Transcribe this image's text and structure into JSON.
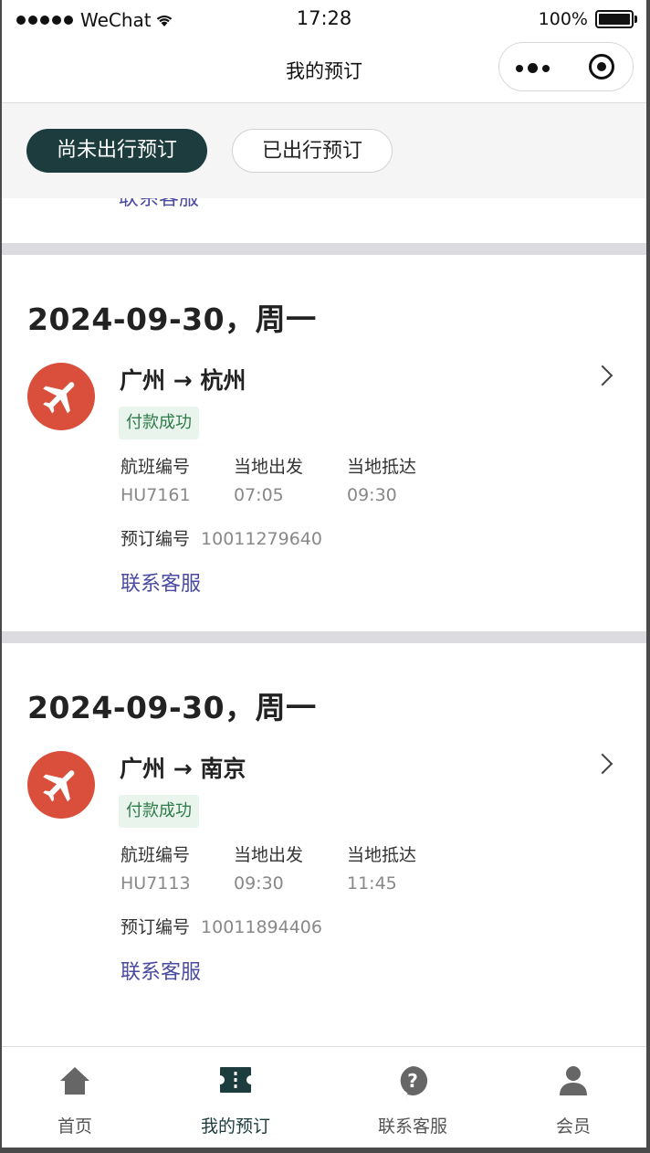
{
  "status_bar": {
    "carrier": "WeChat",
    "time": "17:28",
    "battery": "100%"
  },
  "nav": {
    "title": "我的预订"
  },
  "filter_tabs": [
    {
      "label": "尚未出行预订",
      "active": true
    },
    {
      "label": "已出行预订",
      "active": false
    }
  ],
  "peek": {
    "contact_label": "联系客服"
  },
  "bookings": [
    {
      "date": "2024-09-30，周一",
      "route": "广州 → 杭州",
      "status": "付款成功",
      "flight_label": "航班编号",
      "flight_no": "HU7161",
      "depart_label": "当地出发",
      "depart_time": "07:05",
      "arrive_label": "当地抵达",
      "arrive_time": "09:30",
      "booking_label": "预订编号",
      "booking_no": "10011279640",
      "contact_label": "联系客服"
    },
    {
      "date": "2024-09-30，周一",
      "route": "广州 → 南京",
      "status": "付款成功",
      "flight_label": "航班编号",
      "flight_no": "HU7113",
      "depart_label": "当地出发",
      "depart_time": "09:30",
      "arrive_label": "当地抵达",
      "arrive_time": "11:45",
      "booking_label": "预订编号",
      "booking_no": "10011894406",
      "contact_label": "联系客服"
    }
  ],
  "tab_bar": [
    {
      "label": "首页",
      "icon": "home-icon",
      "active": false
    },
    {
      "label": "我的预订",
      "icon": "ticket-icon",
      "active": true
    },
    {
      "label": "联系客服",
      "icon": "help-icon",
      "active": false
    },
    {
      "label": "会员",
      "icon": "user-icon",
      "active": false
    }
  ],
  "colors": {
    "primary": "#1c3c3d",
    "plane_badge": "#d94f3c",
    "link": "#4a4aa0",
    "status_bg": "#e8f4ec",
    "status_text": "#2e7a48"
  }
}
